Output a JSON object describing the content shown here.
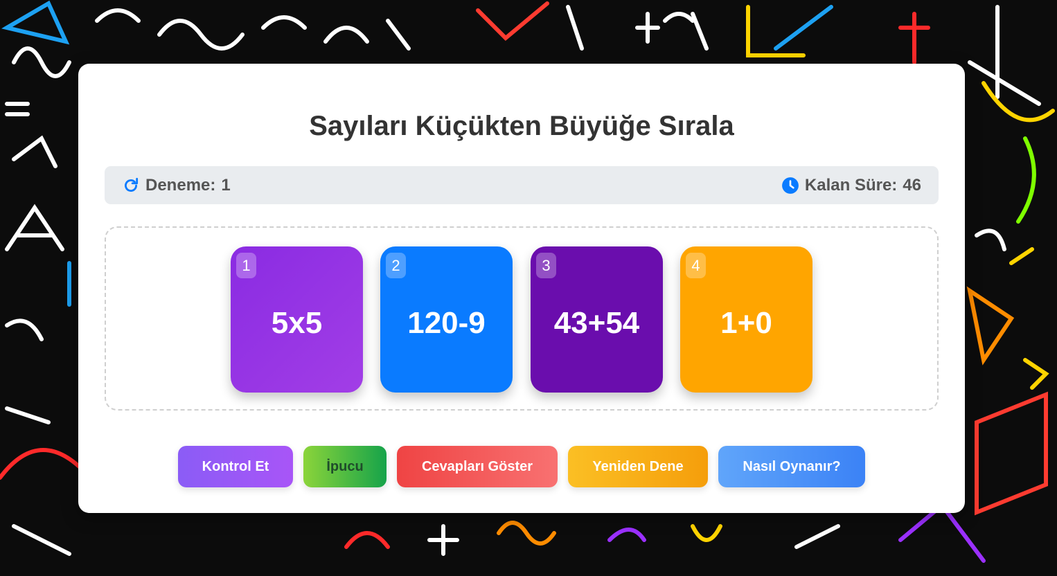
{
  "game": {
    "title": "Sayıları Küçükten Büyüğe Sırala",
    "attempts_label": "Deneme:",
    "attempts_value": "1",
    "time_label": "Kalan Süre:",
    "time_value": "46"
  },
  "tiles": [
    {
      "index": "1",
      "expression": "5x5",
      "color": "#8a2be2"
    },
    {
      "index": "2",
      "expression": "120-9",
      "color": "#0a7bff"
    },
    {
      "index": "3",
      "expression": "43+54",
      "color": "#6a0dad"
    },
    {
      "index": "4",
      "expression": "1+0",
      "color": "#ffa500"
    }
  ],
  "buttons": {
    "check": "Kontrol Et",
    "hint": "İpucu",
    "show_answers": "Cevapları Göster",
    "retry": "Yeniden Dene",
    "how_to_play": "Nasıl Oynanır?"
  },
  "icons": {
    "attempts": "refresh-icon",
    "timer": "clock-icon"
  },
  "colors": {
    "accent": "#0a7bff",
    "check_button": "#8b5cf6",
    "hint_button": "#4caf50",
    "show_answers_button": "#ef5350",
    "retry_button": "#f5a623",
    "how_to_play_button": "#3b82f6"
  }
}
